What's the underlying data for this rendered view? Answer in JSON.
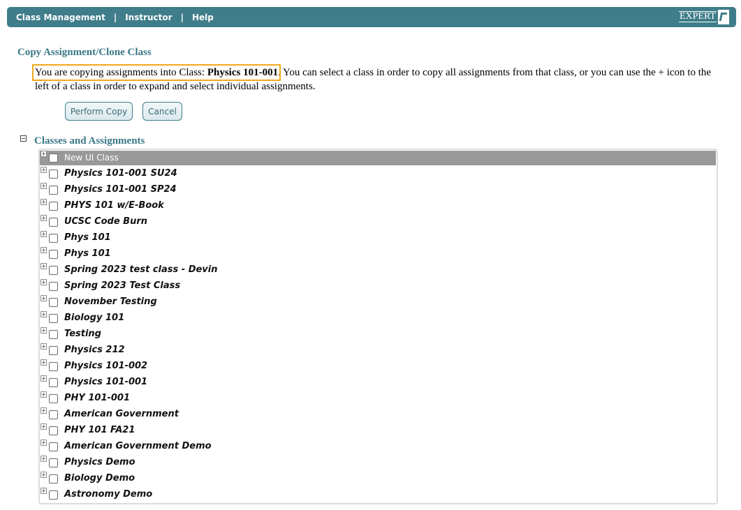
{
  "nav": {
    "items": [
      "Class Management",
      "Instructor",
      "Help"
    ],
    "separator": "|",
    "logo_text": "EXPERT"
  },
  "page": {
    "title": "Copy Assignment/Clone Class",
    "intro_prefix": "You are copying assignments into Class: ",
    "intro_class": "Physics 101-001",
    "intro_suffix": ". You can select a class in order to copy all assignments from that class, or you can use the + icon to the left of a class in order to expand and select individual assignments."
  },
  "buttons": {
    "perform_copy": "Perform Copy",
    "cancel": "Cancel"
  },
  "tree": {
    "title": "Classes and Assignments",
    "items": [
      {
        "label": "New UI Class",
        "selected": true
      },
      {
        "label": "Physics 101-001 SU24",
        "selected": false
      },
      {
        "label": "Physics 101-001 SP24",
        "selected": false
      },
      {
        "label": "PHYS 101 w/E-Book",
        "selected": false
      },
      {
        "label": "UCSC Code Burn",
        "selected": false
      },
      {
        "label": "Phys 101",
        "selected": false
      },
      {
        "label": "Phys 101",
        "selected": false
      },
      {
        "label": "Spring 2023 test class - Devin",
        "selected": false
      },
      {
        "label": "Spring 2023 Test Class",
        "selected": false
      },
      {
        "label": "November Testing",
        "selected": false
      },
      {
        "label": "Biology 101",
        "selected": false
      },
      {
        "label": "Testing",
        "selected": false
      },
      {
        "label": "Physics 212",
        "selected": false
      },
      {
        "label": "Physics 101-002",
        "selected": false
      },
      {
        "label": "Physics 101-001",
        "selected": false
      },
      {
        "label": "PHY 101-001",
        "selected": false
      },
      {
        "label": "American Government",
        "selected": false
      },
      {
        "label": "PHY 101 FA21",
        "selected": false
      },
      {
        "label": "American Government Demo",
        "selected": false
      },
      {
        "label": "Physics Demo",
        "selected": false
      },
      {
        "label": "Biology Demo",
        "selected": false
      },
      {
        "label": "Astronomy Demo",
        "selected": false
      }
    ]
  }
}
